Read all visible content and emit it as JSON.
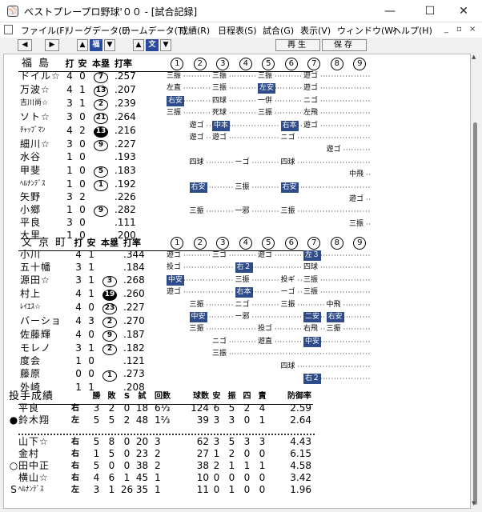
{
  "window": {
    "title": "ベストプレープロ野球'００ - [試合記録]",
    "minimize": "—",
    "maximize": "☐",
    "close": "✕"
  },
  "menu": [
    "ファイル(F)",
    "リーグデータ(L)",
    "チームデータ(T)",
    "成績(R)",
    "日程表(S)",
    "試合(G)",
    "表示(V)",
    "ウィンドウ(W)",
    "ヘルプ(H)"
  ],
  "mdi_controls": [
    "_",
    "▫",
    "×"
  ],
  "toolbar": {
    "team_up": "▲",
    "team_label": "福",
    "team_down": "▼",
    "team2_up": "▲",
    "team2_label": "文",
    "team2_down": "▼",
    "prev": "◀",
    "next": "▶",
    "replay": "再生",
    "save": "保存"
  },
  "batting": {
    "headers": {
      "ab": "打",
      "h": "安",
      "hr": "本塁",
      "avg": "打率"
    },
    "innings": [
      "1",
      "2",
      "3",
      "4",
      "5",
      "6",
      "7",
      "8",
      "9"
    ],
    "teams": [
      {
        "name": "福島",
        "players": [
          {
            "name": "ドイル☆",
            "ab": "4",
            "h": "0",
            "hr": "7",
            "filled": false,
            "avg": ".257",
            "plays": [
              {
                "i": 0,
                "t": "三振",
                "hit": false
              },
              {
                "i": 2,
                "t": "三振",
                "hit": false
              },
              {
                "i": 4,
                "t": "三振",
                "hit": false
              },
              {
                "i": 6,
                "t": "遊ゴ",
                "hit": false
              }
            ]
          },
          {
            "name": "万波☆",
            "ab": "4",
            "h": "1",
            "hr": "13",
            "filled": false,
            "avg": ".207",
            "plays": [
              {
                "i": 0,
                "t": "左直",
                "hit": false
              },
              {
                "i": 2,
                "t": "三振",
                "hit": false
              },
              {
                "i": 4,
                "t": "左安",
                "hit": true
              },
              {
                "i": 6,
                "t": "遊ゴ",
                "hit": false
              }
            ]
          },
          {
            "name": "吉川尚☆",
            "ab": "3",
            "h": "1",
            "hr": "2",
            "filled": false,
            "avg": ".239",
            "small": true,
            "plays": [
              {
                "i": 0,
                "t": "右安",
                "hit": true
              },
              {
                "i": 2,
                "t": "四球",
                "hit": false
              },
              {
                "i": 4,
                "t": "一併",
                "hit": false
              },
              {
                "i": 6,
                "t": "ニゴ",
                "hit": false
              }
            ]
          },
          {
            "name": "ソト☆",
            "ab": "3",
            "h": "0",
            "hr": "21",
            "filled": false,
            "avg": ".264",
            "plays": [
              {
                "i": 0,
                "t": "三振",
                "hit": false
              },
              {
                "i": 2,
                "t": "死球",
                "hit": false
              },
              {
                "i": 4,
                "t": "三振",
                "hit": false
              },
              {
                "i": 6,
                "t": "左飛",
                "hit": false
              }
            ]
          },
          {
            "name": "ﾁｬｯﾌﾞﾏﾝ",
            "ab": "4",
            "h": "2",
            "hr": "13",
            "filled": true,
            "avg": ".216",
            "small": true,
            "plays": [
              {
                "i": 1,
                "t": "遊ゴ",
                "hit": false
              },
              {
                "i": 2,
                "t": "中本",
                "hit": true
              },
              {
                "i": 5,
                "t": "右本",
                "hit": true
              },
              {
                "i": 6,
                "t": "遊ゴ",
                "hit": false
              }
            ]
          },
          {
            "name": "細川☆",
            "ab": "3",
            "h": "0",
            "hr": "9",
            "filled": false,
            "avg": ".227",
            "plays": [
              {
                "i": 1,
                "t": "遊ゴ",
                "hit": false
              },
              {
                "i": 2,
                "t": "遊ゴ",
                "hit": false
              },
              {
                "i": 5,
                "t": "ニゴ",
                "hit": false
              }
            ]
          },
          {
            "name": "水谷",
            "ab": "1",
            "h": "0",
            "hr": "",
            "filled": false,
            "avg": ".193",
            "plays": [
              {
                "i": 7,
                "t": "遊ゴ",
                "hit": false
              }
            ]
          },
          {
            "name": "甲斐",
            "ab": "1",
            "h": "0",
            "hr": "5",
            "filled": false,
            "avg": ".183",
            "plays": [
              {
                "i": 1,
                "t": "四球",
                "hit": false
              },
              {
                "i": 3,
                "t": "ーゴ",
                "hit": false
              },
              {
                "i": 5,
                "t": "四球",
                "hit": false
              }
            ]
          },
          {
            "name": "ﾍﾙﾅﾝﾃﾞｽ",
            "ab": "1",
            "h": "0",
            "hr": "1",
            "filled": false,
            "avg": ".192",
            "small": true,
            "plays": [
              {
                "i": 8,
                "t": "中飛",
                "hit": false
              }
            ]
          },
          {
            "name": "矢野",
            "ab": "3",
            "h": "2",
            "hr": "",
            "filled": false,
            "avg": ".226",
            "plays": [
              {
                "i": 1,
                "t": "右安",
                "hit": true
              },
              {
                "i": 3,
                "t": "三振",
                "hit": false
              },
              {
                "i": 5,
                "t": "右安",
                "hit": true
              }
            ]
          },
          {
            "name": "小郷",
            "ab": "1",
            "h": "0",
            "hr": "9",
            "filled": false,
            "avg": ".282",
            "plays": [
              {
                "i": 8,
                "t": "遊ゴ",
                "hit": false
              }
            ]
          },
          {
            "name": "平良",
            "ab": "3",
            "h": "0",
            "hr": "",
            "filled": false,
            "avg": ".111",
            "plays": [
              {
                "i": 1,
                "t": "三振",
                "hit": false
              },
              {
                "i": 3,
                "t": "一邪",
                "hit": false
              },
              {
                "i": 5,
                "t": "三振",
                "hit": false
              }
            ]
          },
          {
            "name": "大里",
            "ab": "1",
            "h": "0",
            "hr": "",
            "filled": false,
            "avg": ".200",
            "plays": [
              {
                "i": 8,
                "t": "三振",
                "hit": false
              }
            ]
          }
        ]
      },
      {
        "name": "文京町",
        "players": [
          {
            "name": "小川",
            "ab": "4",
            "h": "1",
            "hr": "",
            "filled": false,
            "avg": ".344",
            "plays": [
              {
                "i": 0,
                "t": "遊ゴ",
                "hit": false
              },
              {
                "i": 2,
                "t": "三ゴ",
                "hit": false
              },
              {
                "i": 4,
                "t": "遊ゴ",
                "hit": false
              },
              {
                "i": 6,
                "t": "左３",
                "hit": true
              }
            ]
          },
          {
            "name": "五十幡",
            "ab": "3",
            "h": "1",
            "hr": "",
            "filled": false,
            "avg": ".184",
            "plays": [
              {
                "i": 0,
                "t": "投ゴ",
                "hit": false
              },
              {
                "i": 3,
                "t": "右２",
                "hit": true
              },
              {
                "i": 6,
                "t": "四球",
                "hit": false
              }
            ]
          },
          {
            "name": "源田☆",
            "ab": "3",
            "h": "1",
            "hr": "3",
            "filled": false,
            "avg": ".268",
            "plays": [
              {
                "i": 0,
                "t": "中安",
                "hit": true
              },
              {
                "i": 3,
                "t": "三振",
                "hit": false
              },
              {
                "i": 5,
                "t": "投ギ",
                "hit": false
              },
              {
                "i": 6,
                "t": "三振",
                "hit": false
              }
            ]
          },
          {
            "name": "村上",
            "ab": "4",
            "h": "1",
            "hr": "19",
            "filled": true,
            "avg": ".260",
            "plays": [
              {
                "i": 0,
                "t": "遊ゴ",
                "hit": false
              },
              {
                "i": 3,
                "t": "右本",
                "hit": true
              },
              {
                "i": 5,
                "t": "ーゴ",
                "hit": false
              },
              {
                "i": 6,
                "t": "三振",
                "hit": false
              }
            ]
          },
          {
            "name": "ﾚｲｴｽ☆",
            "ab": "4",
            "h": "0",
            "hr": "23",
            "filled": false,
            "avg": ".227",
            "small": true,
            "plays": [
              {
                "i": 1,
                "t": "三振",
                "hit": false
              },
              {
                "i": 3,
                "t": "ニゴ",
                "hit": false
              },
              {
                "i": 5,
                "t": "三振",
                "hit": false
              },
              {
                "i": 7,
                "t": "中飛",
                "hit": false
              }
            ]
          },
          {
            "name": "バーショ",
            "ab": "4",
            "h": "3",
            "hr": "2",
            "filled": false,
            "avg": ".270",
            "plays": [
              {
                "i": 1,
                "t": "中安",
                "hit": true
              },
              {
                "i": 3,
                "t": "ー邪",
                "hit": false
              },
              {
                "i": 6,
                "t": "二安",
                "hit": true
              },
              {
                "i": 7,
                "t": "右安",
                "hit": true
              }
            ]
          },
          {
            "name": "佐藤輝",
            "ab": "4",
            "h": "0",
            "hr": "9",
            "filled": false,
            "avg": ".187",
            "plays": [
              {
                "i": 1,
                "t": "三振",
                "hit": false
              },
              {
                "i": 4,
                "t": "投ゴ",
                "hit": false
              },
              {
                "i": 6,
                "t": "右飛",
                "hit": false
              },
              {
                "i": 7,
                "t": "三振",
                "hit": false
              }
            ]
          },
          {
            "name": "モレノ",
            "ab": "3",
            "h": "1",
            "hr": "2",
            "filled": false,
            "avg": ".182",
            "plays": [
              {
                "i": 2,
                "t": "ニゴ",
                "hit": false
              },
              {
                "i": 4,
                "t": "遊直",
                "hit": false
              },
              {
                "i": 6,
                "t": "中安",
                "hit": true
              }
            ]
          },
          {
            "name": "度会",
            "ab": "1",
            "h": "0",
            "hr": "",
            "filled": false,
            "avg": ".121",
            "plays": [
              {
                "i": 2,
                "t": "三振",
                "hit": false
              }
            ]
          },
          {
            "name": "藤原",
            "ab": "0",
            "h": "0",
            "hr": "1",
            "filled": false,
            "avg": ".273",
            "plays": [
              {
                "i": 5,
                "t": "四球",
                "hit": false
              }
            ]
          },
          {
            "name": "外崎",
            "ab": "1",
            "h": "1",
            "hr": "",
            "filled": false,
            "avg": ".208",
            "plays": [
              {
                "i": 6,
                "t": "右２",
                "hit": true
              }
            ]
          }
        ]
      }
    ]
  },
  "pitching": {
    "title": "投手成績",
    "headers": {
      "w": "勝",
      "l": "敗",
      "s": "S",
      "g": "試",
      "ip": "回数",
      "np": "球数",
      "h": "安",
      "so": "振",
      "bb": "四",
      "er": "責",
      "era": "防御率"
    },
    "teams": [
      [
        {
          "mark": "",
          "name": "平良",
          "hand": "右",
          "w": "3",
          "l": "2",
          "s": "0",
          "g": "18",
          "ip": "6⅓",
          "np": "124",
          "h": "6",
          "so": "5",
          "bb": "2",
          "er": "4",
          "era": "2.59"
        },
        {
          "mark": "●",
          "name": "鈴木翔",
          "hand": "左",
          "w": "5",
          "l": "5",
          "s": "2",
          "g": "48",
          "ip": "1⅔",
          "np": "39",
          "h": "3",
          "so": "3",
          "bb": "0",
          "er": "1",
          "era": "2.64"
        }
      ],
      [
        {
          "mark": "",
          "name": "山下☆",
          "hand": "右",
          "w": "5",
          "l": "8",
          "s": "0",
          "g": "20",
          "ip": "3",
          "np": "62",
          "h": "3",
          "so": "5",
          "bb": "3",
          "er": "3",
          "era": "4.43"
        },
        {
          "mark": "",
          "name": "金村",
          "hand": "右",
          "w": "1",
          "l": "5",
          "s": "0",
          "g": "23",
          "ip": "2",
          "np": "27",
          "h": "1",
          "so": "2",
          "bb": "0",
          "er": "0",
          "era": "6.15"
        },
        {
          "mark": "○",
          "name": "田中正",
          "hand": "右",
          "w": "5",
          "l": "0",
          "s": "0",
          "g": "38",
          "ip": "2",
          "np": "38",
          "h": "2",
          "so": "1",
          "bb": "1",
          "er": "1",
          "era": "4.58"
        },
        {
          "mark": "",
          "name": "横山☆",
          "hand": "右",
          "w": "4",
          "l": "6",
          "s": "1",
          "g": "45",
          "ip": "1",
          "np": "10",
          "h": "0",
          "so": "0",
          "bb": "0",
          "er": "0",
          "era": "3.42"
        },
        {
          "mark": "S",
          "name": "ﾍﾙﾅﾝﾃﾞｽ",
          "hand": "左",
          "w": "3",
          "l": "1",
          "s": "26",
          "g": "35",
          "ip": "1",
          "np": "11",
          "h": "0",
          "so": "1",
          "bb": "0",
          "er": "0",
          "era": "1.96"
        }
      ]
    ]
  }
}
